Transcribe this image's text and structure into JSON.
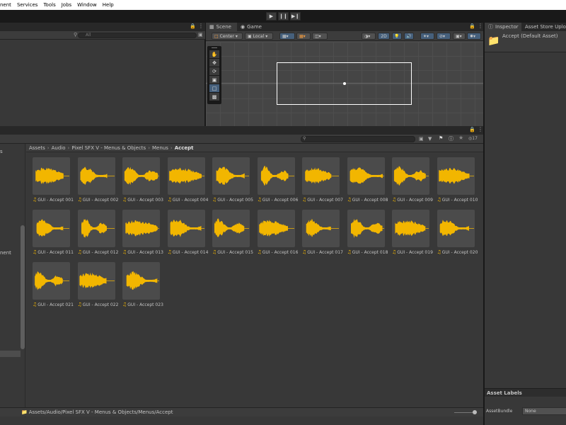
{
  "menubar": {
    "items": [
      "nent",
      "Services",
      "Tools",
      "Jobs",
      "Window",
      "Help"
    ]
  },
  "toolbar": {
    "play_icon": "play-icon",
    "pause_icon": "pause-icon",
    "step_icon": "step-icon"
  },
  "hierarchy": {
    "search_placeholder": "All",
    "partial_items": [
      "s",
      "nent"
    ]
  },
  "scene": {
    "tabs": [
      {
        "label": "Scene",
        "icon": "grid-icon"
      },
      {
        "label": "Game",
        "icon": "gamepad-icon"
      }
    ],
    "pivot_label": "Center",
    "space_label": "Local",
    "mode_2d_label": "2D"
  },
  "inspector": {
    "tabs": [
      {
        "label": "Inspector",
        "icon": "info-icon"
      },
      {
        "label": "Asset Store Uploade",
        "icon": null
      }
    ],
    "asset_title": "Accept (Default Asset)",
    "labels_header": "Asset Labels",
    "assetbundle_label": "AssetBundle",
    "assetbundle_value": "None"
  },
  "project": {
    "hidden_count": "17",
    "breadcrumb": [
      "Assets",
      "Audio",
      "Pixel SFX V - Menus & Objects",
      "Menus",
      "Accept"
    ],
    "status_path": "Assets/Audio/Pixel SFX V - Menus & Objects/Menus/Accept",
    "assets": [
      {
        "name": "GUI - Accept 001"
      },
      {
        "name": "GUI - Accept 002"
      },
      {
        "name": "GUI - Accept 003"
      },
      {
        "name": "GUI - Accept 004"
      },
      {
        "name": "GUI - Accept 005"
      },
      {
        "name": "GUI - Accept 006"
      },
      {
        "name": "GUI - Accept 007"
      },
      {
        "name": "GUI - Accept 008"
      },
      {
        "name": "GUI - Accept 009"
      },
      {
        "name": "GUI - Accept 010"
      },
      {
        "name": "GUI - Accept 011"
      },
      {
        "name": "GUI - Accept 012"
      },
      {
        "name": "GUI - Accept 013"
      },
      {
        "name": "GUI - Accept 014"
      },
      {
        "name": "GUI - Accept 015"
      },
      {
        "name": "GUI - Accept 016"
      },
      {
        "name": "GUI - Accept 017"
      },
      {
        "name": "GUI - Accept 018"
      },
      {
        "name": "GUI - Accept 019"
      },
      {
        "name": "GUI - Accept 020"
      },
      {
        "name": "GUI - Accept 021"
      },
      {
        "name": "GUI - Accept 022"
      },
      {
        "name": "GUI - Accept 023"
      }
    ]
  },
  "colors": {
    "waveform": "#f2b600",
    "selected_button": "#46607c",
    "panel_bg": "#383838"
  }
}
